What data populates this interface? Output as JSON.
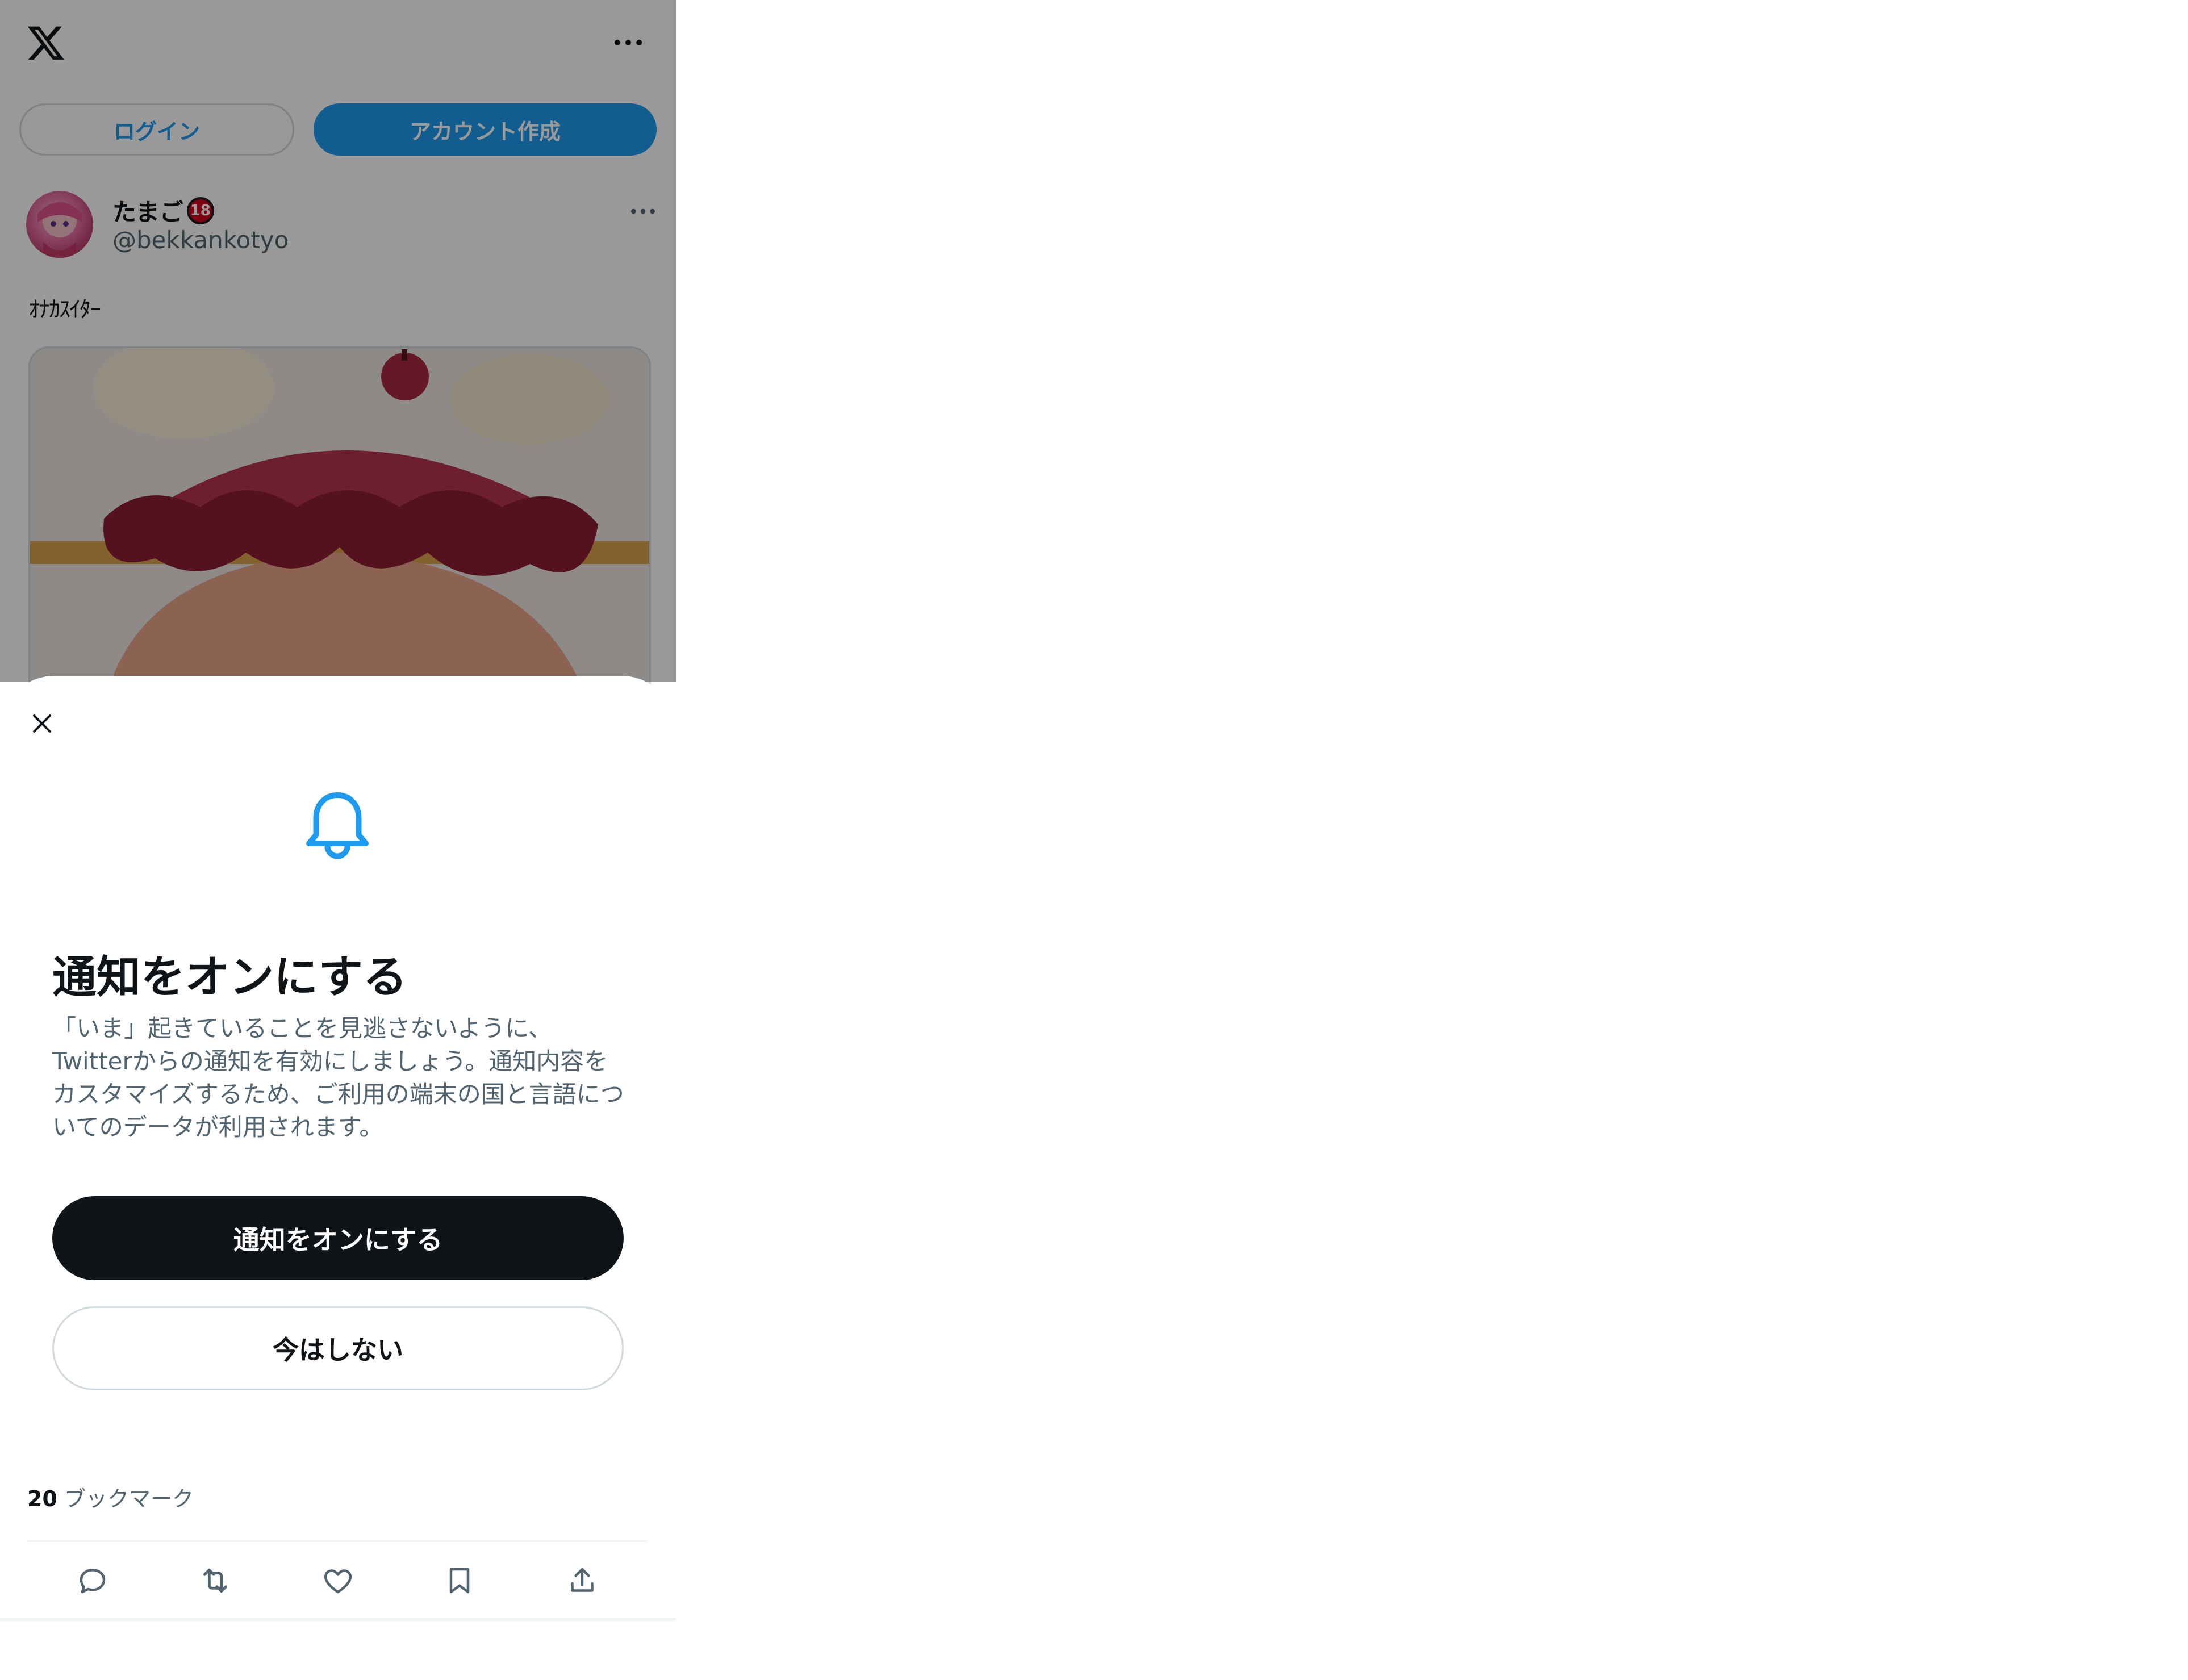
{
  "header": {
    "logo_icon": "x-logo-icon",
    "more_icon": "more-horizontal-icon"
  },
  "auth": {
    "login_label": "ログイン",
    "signup_label": "アカウント作成"
  },
  "tweet": {
    "display_name": "たまご",
    "badge": "18",
    "handle": "@bekkankotyo",
    "text": "ｵﾅｶｽｲﾀｰ",
    "bookmark_count": "20",
    "bookmark_label": "ブックマーク"
  },
  "sheet": {
    "close_icon": "close-icon",
    "bell_icon": "bell-icon",
    "title": "通知をオンにする",
    "body": "「いま」起きていることを見逃さないように、Twitterからの通知を有効にしましょう。通知内容をカスタマイズするため、ご利用の端末の国と言語についてのデータが利用されます。",
    "primary_button": "通知をオンにする",
    "secondary_button": "今はしない"
  },
  "actions": [
    "reply-icon",
    "retweet-icon",
    "like-icon",
    "bookmark-icon",
    "share-icon"
  ],
  "colors": {
    "accent": "#1d9bf0",
    "text_primary": "#0f1419",
    "text_secondary": "#536471",
    "border": "#cfd9de",
    "overlay": "rgba(0,0,0,0.4)"
  }
}
